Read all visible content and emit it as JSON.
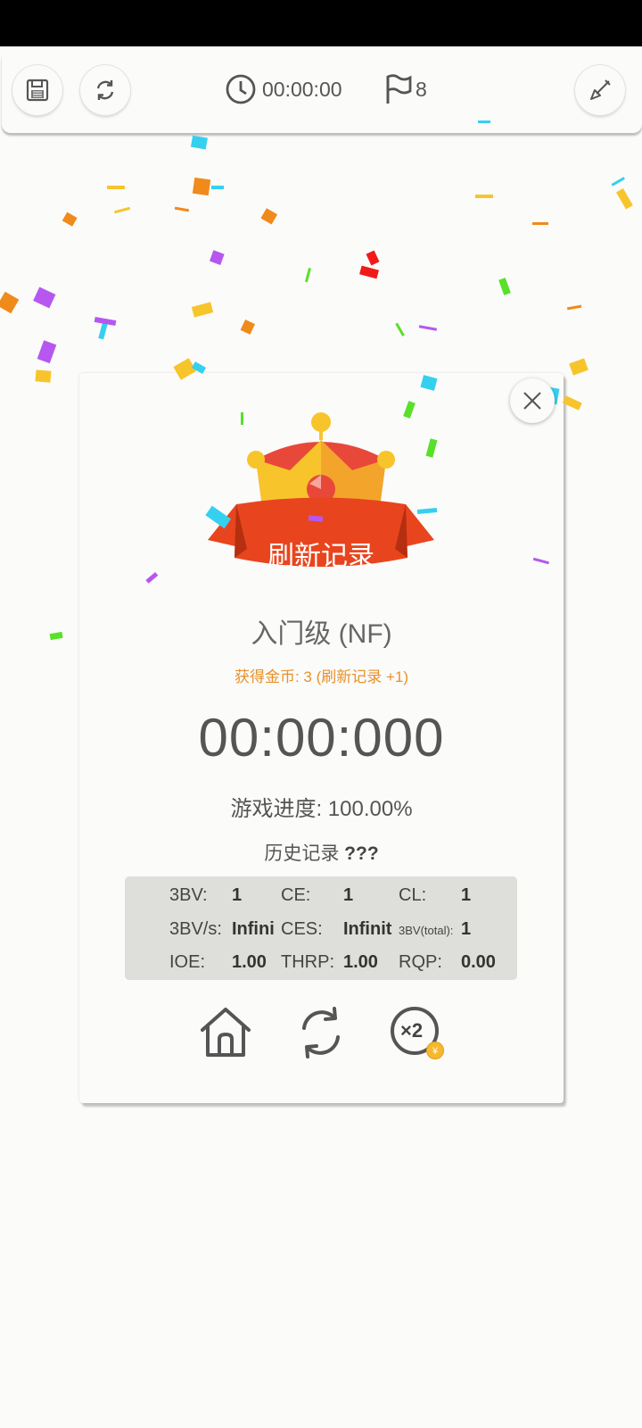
{
  "toolbar": {
    "save_icon": "save-icon",
    "restart_icon": "refresh-icon",
    "timer": "00:00:00",
    "flag_count": "8",
    "shovel_icon": "shovel-icon"
  },
  "dialog": {
    "banner": "刷新记录",
    "level": "入门级 (NF)",
    "coins": "获得金币: 3 (刷新记录 +1)",
    "time": "00:00:000",
    "progress_label": "游戏进度:",
    "progress_value": "100.00%",
    "history_label": "历史记录",
    "history_value": "???",
    "stats": {
      "bv_label": "3BV:",
      "bv_value": "1",
      "ce_label": "CE:",
      "ce_value": "1",
      "cl_label": "CL:",
      "cl_value": "1",
      "bvs_label": "3BV/s:",
      "bvs_value": "Infini",
      "ces_label": "CES:",
      "ces_value": "Infinit",
      "bvtotal_label": "3BV(total):",
      "bvtotal_value": "1",
      "ioe_label": "IOE:",
      "ioe_value": "1.00",
      "thrp_label": "THRP:",
      "thrp_value": "1.00",
      "rqp_label": "RQP:",
      "rqp_value": "0.00"
    },
    "bottom_buttons": {
      "home_icon": "home-icon",
      "replay_icon": "refresh-icon",
      "double_label": "×2",
      "coin_symbol": "¥"
    }
  },
  "colors": {
    "background": "#fbfbf9",
    "banner_red": "#e8451e",
    "crown_yellow": "#f7c52b",
    "coins_orange": "#e8912a",
    "stats_bg": "#dededb"
  }
}
